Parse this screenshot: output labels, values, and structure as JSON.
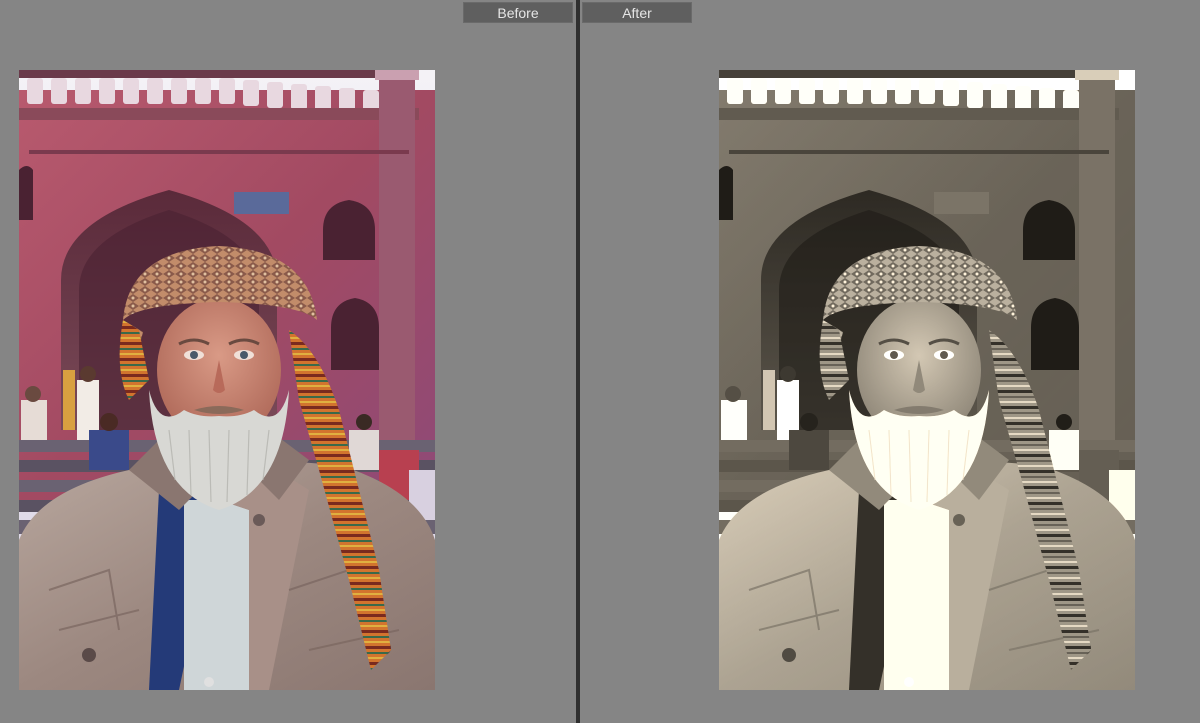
{
  "compare": {
    "before_label": "Before",
    "after_label": "After"
  },
  "colors": {
    "background": "#858585",
    "label_bg": "#5f5f5f",
    "label_text": "#e6e6e6",
    "divider": "#2f2f2f"
  },
  "photo": {
    "subject": "portrait-of-bearded-man-in-turban-before-mosque-gate",
    "before_style": "color",
    "after_style": "black-and-white-sepia"
  }
}
